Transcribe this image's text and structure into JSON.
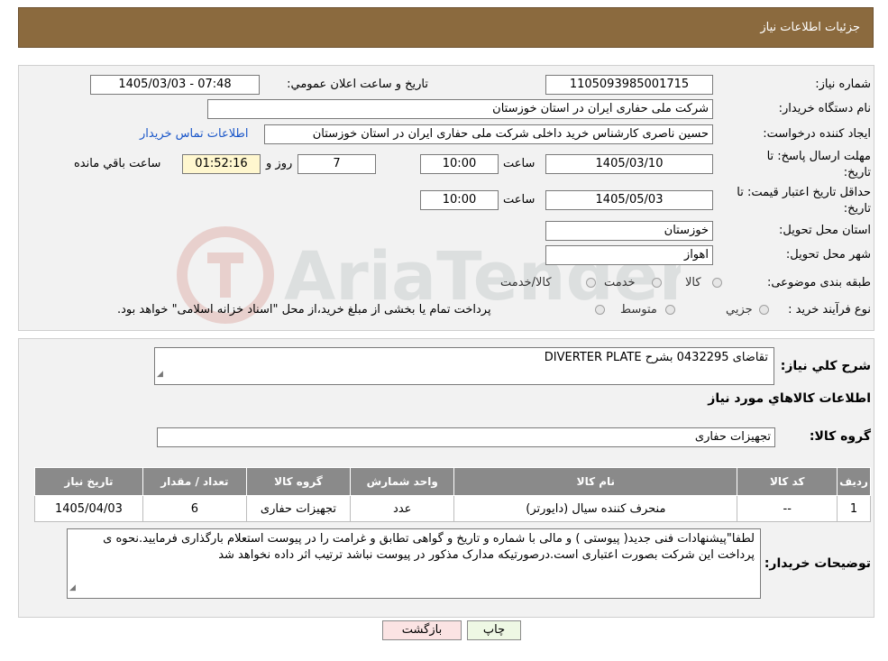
{
  "header": {
    "title": "جزئیات اطلاعات نیاز"
  },
  "form": {
    "need_number_label": "شماره نیاز:",
    "need_number": "1105093985001715",
    "announce_label": "تاریخ و ساعت اعلان عمومي:",
    "announce_value": "1405/03/03 - 07:48",
    "buyer_org_label": "نام دستگاه خريدار:",
    "buyer_org": "شرکت ملی حفاری ایران در استان خوزستان",
    "requester_label": "ايجاد کننده درخواست:",
    "requester": "حسین ناصری کارشناس خرید داخلی شرکت ملی حفاری ایران در استان خوزستان",
    "contact_link": "اطلاعات تماس خريدار",
    "deadline_label_1": "مهلت ارسال پاسخ: تا",
    "deadline_label_2": "تاریخ:",
    "deadline_date": "1405/03/10",
    "time_word": "ساعت",
    "deadline_time": "10:00",
    "days_value": "7",
    "days_word": "روز و",
    "remaining_time": "01:52:16",
    "remaining_word": "ساعت باقي مانده",
    "validity_label_1": "حداقل تاريخ اعتبار قيمت: تا",
    "validity_label_2": "تاريخ:",
    "validity_date": "1405/05/03",
    "validity_time": "10:00",
    "province_label": "استان محل تحويل:",
    "province": "خوزستان",
    "city_label": "شهر محل تحويل:",
    "city": "اهواز",
    "category_label": "طبقه بندی موضوعی:",
    "category_options": [
      "کالا",
      "خدمت",
      "کالا/خدمت"
    ],
    "process_label": "نوع فرآيند خريد :",
    "process_options": [
      "جزيي",
      "متوسط"
    ],
    "process_note": "پرداخت تمام يا بخشی از مبلغ خريد،از محل \"اسناد خزانه اسلامی\" خواهد بود."
  },
  "summary": {
    "label": "شرح کلي نياز:",
    "value": "تقاضای 0432295 بشرح DIVERTER PLATE",
    "goods_info_title": "اطلاعات کالاهاي مورد نياز",
    "group_label": "گروه کالا:",
    "group_value": "تجهیزات حفاری"
  },
  "table": {
    "headers": [
      "رديف",
      "کد کالا",
      "نام کالا",
      "واحد شمارش",
      "گروه کالا",
      "تعداد / مقدار",
      "تاريخ نياز"
    ],
    "rows": [
      [
        "1",
        "--",
        "منحرف کننده سیال (دایورتر)",
        "عدد",
        "تجهیزات حفاری",
        "6",
        "1405/04/03"
      ]
    ]
  },
  "buyer_notes": {
    "label": "توضیحات خریدار:",
    "value": "لطفا\"پیشنهادات فنی جدید( پیوستی ) و مالی با شماره و تاریخ و گواهی تطابق و غرامت را در پیوست استعلام بارگذاری فرمایید.نحوه ی پرداخت این شرکت بصورت اعتباری است.درصورتیکه مدارک مذکور در پیوست نباشد ترتیب اثر داده نخواهد شد"
  },
  "buttons": {
    "print": "چاپ",
    "back": "بازگشت"
  },
  "colors": {
    "header_bg": "#8b6a3e",
    "table_header_bg": "#8a8a8a",
    "print_bg": "#eef8e4",
    "back_bg": "#fbe3e3",
    "link": "#1a56c9"
  }
}
